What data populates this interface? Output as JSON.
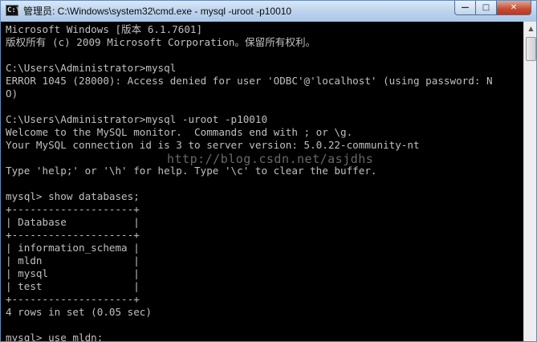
{
  "window": {
    "title": "管理员: C:\\Windows\\system32\\cmd.exe - mysql  -uroot -p10010",
    "icon": "console-icon",
    "buttons": {
      "minimize": "—",
      "maximize": "□",
      "close": "✕"
    }
  },
  "console": {
    "lines": [
      "Microsoft Windows [版本 6.1.7601]",
      "版权所有 (c) 2009 Microsoft Corporation。保留所有权利。",
      "",
      "C:\\Users\\Administrator>mysql",
      "ERROR 1045 (28000): Access denied for user 'ODBC'@'localhost' (using password: N",
      "O)",
      "",
      "C:\\Users\\Administrator>mysql -uroot -p10010",
      "Welcome to the MySQL monitor.  Commands end with ; or \\g.",
      "Your MySQL connection id is 3 to server version: 5.0.22-community-nt",
      "",
      "Type 'help;' or '\\h' for help. Type '\\c' to clear the buffer.",
      "",
      "mysql> show databases;",
      "+--------------------+",
      "| Database           |",
      "+--------------------+",
      "| information_schema |",
      "| mldn               |",
      "| mysql              |",
      "| test               |",
      "+--------------------+",
      "4 rows in set (0.05 sec)",
      "",
      "mysql> use mldn;"
    ],
    "watermark": "http://blog.csdn.net/asjdhs"
  },
  "scrollbar": {
    "up_arrow": "▲"
  }
}
